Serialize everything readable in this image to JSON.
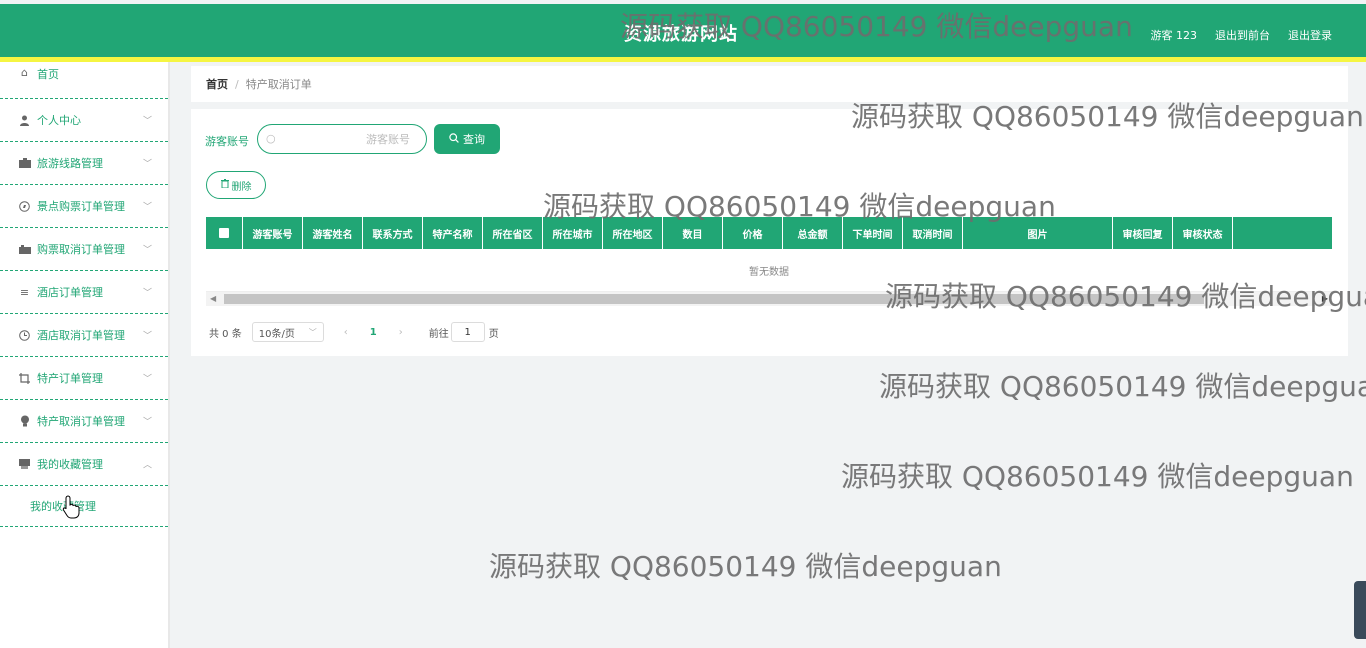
{
  "header": {
    "site_title": "资源旅游网站",
    "user_label": "游客 123",
    "back_to_front": "退出到前台",
    "logout": "退出登录"
  },
  "sidebar": {
    "items": [
      {
        "label": "首页",
        "icon": "home-icon"
      },
      {
        "label": "个人中心",
        "icon": "user-icon"
      },
      {
        "label": "旅游线路管理",
        "icon": "briefcase-icon"
      },
      {
        "label": "景点购票订单管理",
        "icon": "compass-icon"
      },
      {
        "label": "购票取消订单管理",
        "icon": "camera-icon"
      },
      {
        "label": "酒店订单管理",
        "icon": "list-icon"
      },
      {
        "label": "酒店取消订单管理",
        "icon": "clock-icon"
      },
      {
        "label": "特产订单管理",
        "icon": "crop-icon"
      },
      {
        "label": "特产取消订单管理",
        "icon": "bulb-icon"
      },
      {
        "label": "我的收藏管理",
        "icon": "folder-icon"
      }
    ],
    "submenu_label": "我的收藏管理"
  },
  "breadcrumb": {
    "home": "首页",
    "separator": "/",
    "current": "特产取消订单"
  },
  "search": {
    "label": "游客账号",
    "placeholder": "游客账号",
    "query_button": "查询"
  },
  "actions": {
    "delete_button": "删除"
  },
  "table": {
    "columns": [
      "游客账号",
      "游客姓名",
      "联系方式",
      "特产名称",
      "所在省区",
      "所在城市",
      "所在地区",
      "数目",
      "价格",
      "总金额",
      "下单时间",
      "取消时间",
      "图片",
      "审核回复",
      "审核状态"
    ],
    "empty_text": "暂无数据"
  },
  "pagination": {
    "total": "共 0 条",
    "page_size": "10条/页",
    "current_page": "1",
    "goto_label": "前往",
    "goto_value": "1",
    "page_unit": "页"
  },
  "watermark": {
    "text": "源码获取 QQ86050149 微信deepguan"
  },
  "colors": {
    "primary": "#21a675",
    "accent_strip": "#f5f542"
  }
}
